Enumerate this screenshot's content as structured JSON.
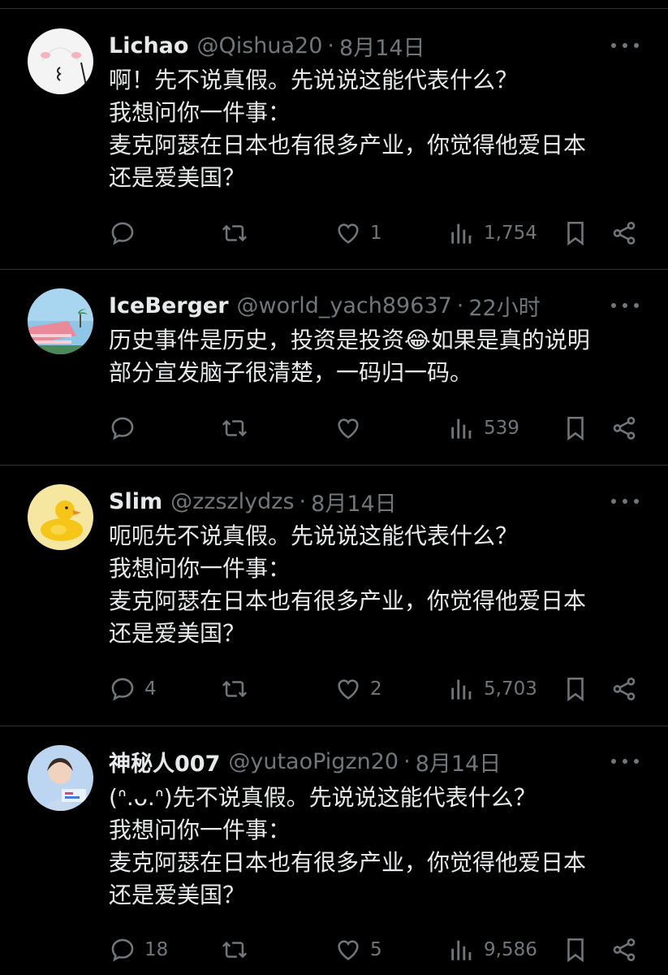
{
  "tweets": [
    {
      "name": "Lichao",
      "handle": "@Qishua20",
      "separator": "·",
      "time": "8月14日",
      "lines": [
        "啊！先不说真假。先说说这能代表什么？",
        "我想问你一件事：",
        "麦克阿瑟在日本也有很多产业，你觉得他爱日本",
        "还是爱美国？"
      ],
      "replies": "",
      "retweets": "",
      "likes": "1",
      "views": "1,754",
      "avatar": "sketch-face-avatar"
    },
    {
      "name": "IceBerger",
      "handle": "@world_yach89637",
      "separator": "·",
      "time": "22小时",
      "lines": [
        "历史事件是历史，投资是投资😂如果是真的说明",
        "部分宣发脑子很清楚，一码归一码。"
      ],
      "replies": "",
      "retweets": "",
      "likes": "",
      "views": "539",
      "avatar": "beach-house-avatar"
    },
    {
      "name": "Slim",
      "handle": "@zzszlydzs",
      "separator": "·",
      "time": "8月14日",
      "lines": [
        "呃呃先不说真假。先说说这能代表什么？",
        "我想问你一件事：",
        "麦克阿瑟在日本也有很多产业，你觉得他爱日本",
        "还是爱美国？"
      ],
      "replies": "4",
      "retweets": "",
      "likes": "2",
      "views": "5,703",
      "avatar": "rubber-duck-avatar"
    },
    {
      "name": "神秘人007",
      "handle": "@yutaoPigzn20",
      "separator": "·",
      "time": "8月14日",
      "lines": [
        "(ᐢ.ᴗ.ᐢ)先不说真假。先说说这能代表什么？",
        "我想问你一件事：",
        "麦克阿瑟在日本也有很多产业，你觉得他爱日本",
        "还是爱美国？"
      ],
      "replies": "18",
      "retweets": "",
      "likes": "5",
      "views": "9,586",
      "avatar": "portrait-avatar"
    }
  ],
  "colors": {
    "background": "#000000",
    "text": "#e7e9ea",
    "muted": "#71767b",
    "divider": "#2f3336"
  },
  "icons": [
    "reply-icon",
    "retweet-icon",
    "like-icon",
    "views-icon",
    "bookmark-icon",
    "share-icon",
    "more-icon"
  ]
}
